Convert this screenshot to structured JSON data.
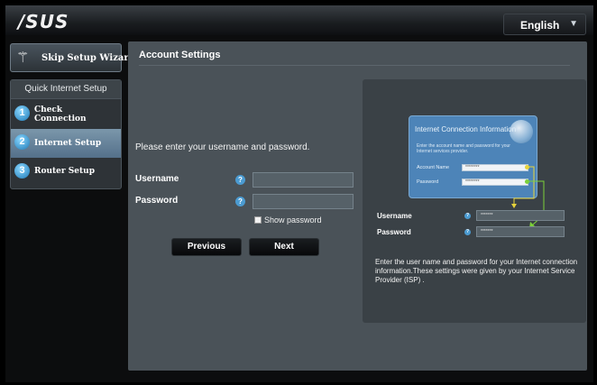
{
  "header": {
    "logo": "/SUS",
    "language": "English"
  },
  "sidebar": {
    "skip_label": "Skip Setup Wizard",
    "section_title": "Quick Internet Setup",
    "steps": [
      {
        "num": "1",
        "label_l1": "Check",
        "label_l2": "Connection"
      },
      {
        "num": "2",
        "label_l1": "Internet Setup",
        "label_l2": ""
      },
      {
        "num": "3",
        "label_l1": "Router Setup",
        "label_l2": ""
      }
    ]
  },
  "main": {
    "title": "Account Settings",
    "prompt": "Please enter your username and password.",
    "username_label": "Username",
    "password_label": "Password",
    "help_glyph": "?",
    "username_value": "",
    "password_value": "",
    "show_password_label": "Show password",
    "previous_label": "Previous",
    "next_label": "Next"
  },
  "illustration": {
    "card_title": "Internet Connection Information",
    "card_desc": "Enter the account name and password for your Internet services provider.",
    "account_name_label": "Account Name",
    "password_label": "Password",
    "masked": "********",
    "username_label": "Username",
    "password_label2": "Password",
    "masked_short": "*******",
    "note": "Enter the user name and password for your Internet connection information.These settings were given by your Internet Service Provider (ISP) ."
  },
  "colors": {
    "accent_blue": "#4b9bd1",
    "active_step": "#6f8ba0",
    "panel": "#4a5258",
    "arrow_green": "#7cd13a",
    "arrow_yellow": "#e6d33a"
  }
}
